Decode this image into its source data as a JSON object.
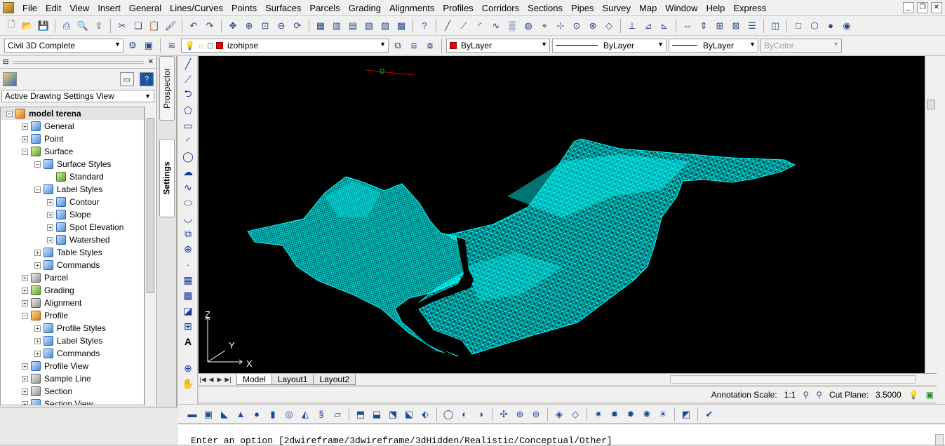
{
  "menu": [
    "File",
    "Edit",
    "View",
    "Insert",
    "General",
    "Lines/Curves",
    "Points",
    "Surfaces",
    "Parcels",
    "Grading",
    "Alignments",
    "Profiles",
    "Corridors",
    "Sections",
    "Pipes",
    "Survey",
    "Map",
    "Window",
    "Help",
    "Express"
  ],
  "toolbar2": {
    "workspace": "Civil 3D Complete",
    "layer": "izohipse",
    "color": "ByLayer",
    "linetype": "ByLayer",
    "lineweight": "ByLayer",
    "plotstyle": "ByColor"
  },
  "panel": {
    "view_select": "Active Drawing Settings View",
    "tree": [
      {
        "label": "model terena",
        "level": 0,
        "icon": "orange",
        "exp": "−",
        "root": true
      },
      {
        "label": "General",
        "level": 1,
        "icon": "blue",
        "exp": "+"
      },
      {
        "label": "Point",
        "level": 1,
        "icon": "blue",
        "exp": "+"
      },
      {
        "label": "Surface",
        "level": 1,
        "icon": "green",
        "exp": "−"
      },
      {
        "label": "Surface Styles",
        "level": 2,
        "icon": "blue",
        "exp": "−"
      },
      {
        "label": "Standard",
        "level": 3,
        "icon": "green",
        "exp": ""
      },
      {
        "label": "Label Styles",
        "level": 2,
        "icon": "blue",
        "exp": "−"
      },
      {
        "label": "Contour",
        "level": 3,
        "icon": "blue",
        "exp": "+"
      },
      {
        "label": "Slope",
        "level": 3,
        "icon": "blue",
        "exp": "+"
      },
      {
        "label": "Spot Elevation",
        "level": 3,
        "icon": "blue",
        "exp": "+"
      },
      {
        "label": "Watershed",
        "level": 3,
        "icon": "blue",
        "exp": "+"
      },
      {
        "label": "Table Styles",
        "level": 2,
        "icon": "blue",
        "exp": "+"
      },
      {
        "label": "Commands",
        "level": 2,
        "icon": "blue",
        "exp": "+"
      },
      {
        "label": "Parcel",
        "level": 1,
        "icon": "gray",
        "exp": "+"
      },
      {
        "label": "Grading",
        "level": 1,
        "icon": "green",
        "exp": "+"
      },
      {
        "label": "Alignment",
        "level": 1,
        "icon": "gray",
        "exp": "+"
      },
      {
        "label": "Profile",
        "level": 1,
        "icon": "orange",
        "exp": "−"
      },
      {
        "label": "Profile Styles",
        "level": 2,
        "icon": "blue",
        "exp": "+"
      },
      {
        "label": "Label Styles",
        "level": 2,
        "icon": "blue",
        "exp": "+"
      },
      {
        "label": "Commands",
        "level": 2,
        "icon": "blue",
        "exp": "+"
      },
      {
        "label": "Profile View",
        "level": 1,
        "icon": "blue",
        "exp": "+"
      },
      {
        "label": "Sample Line",
        "level": 1,
        "icon": "gray",
        "exp": "+"
      },
      {
        "label": "Section",
        "level": 1,
        "icon": "gray",
        "exp": "+"
      },
      {
        "label": "Section View",
        "level": 1,
        "icon": "blue",
        "exp": "+"
      }
    ]
  },
  "side_tabs": {
    "prospector": "Prospector",
    "settings": "Settings"
  },
  "viewport": {
    "axis_x": "X",
    "axis_y": "Y",
    "axis_z": "Z",
    "mesh_color": "#00ffff"
  },
  "layout_tabs": [
    "Model",
    "Layout1",
    "Layout2"
  ],
  "status": {
    "annotation_scale_label": "Annotation Scale:",
    "annotation_scale_value": "1:1",
    "cut_plane_label": "Cut Plane:",
    "cut_plane_value": "3.5000"
  },
  "command_line": {
    "prompt": "Enter an option [2dwireframe/3dwireframe/3dHidden/Realistic/Conceptual/Other]"
  }
}
